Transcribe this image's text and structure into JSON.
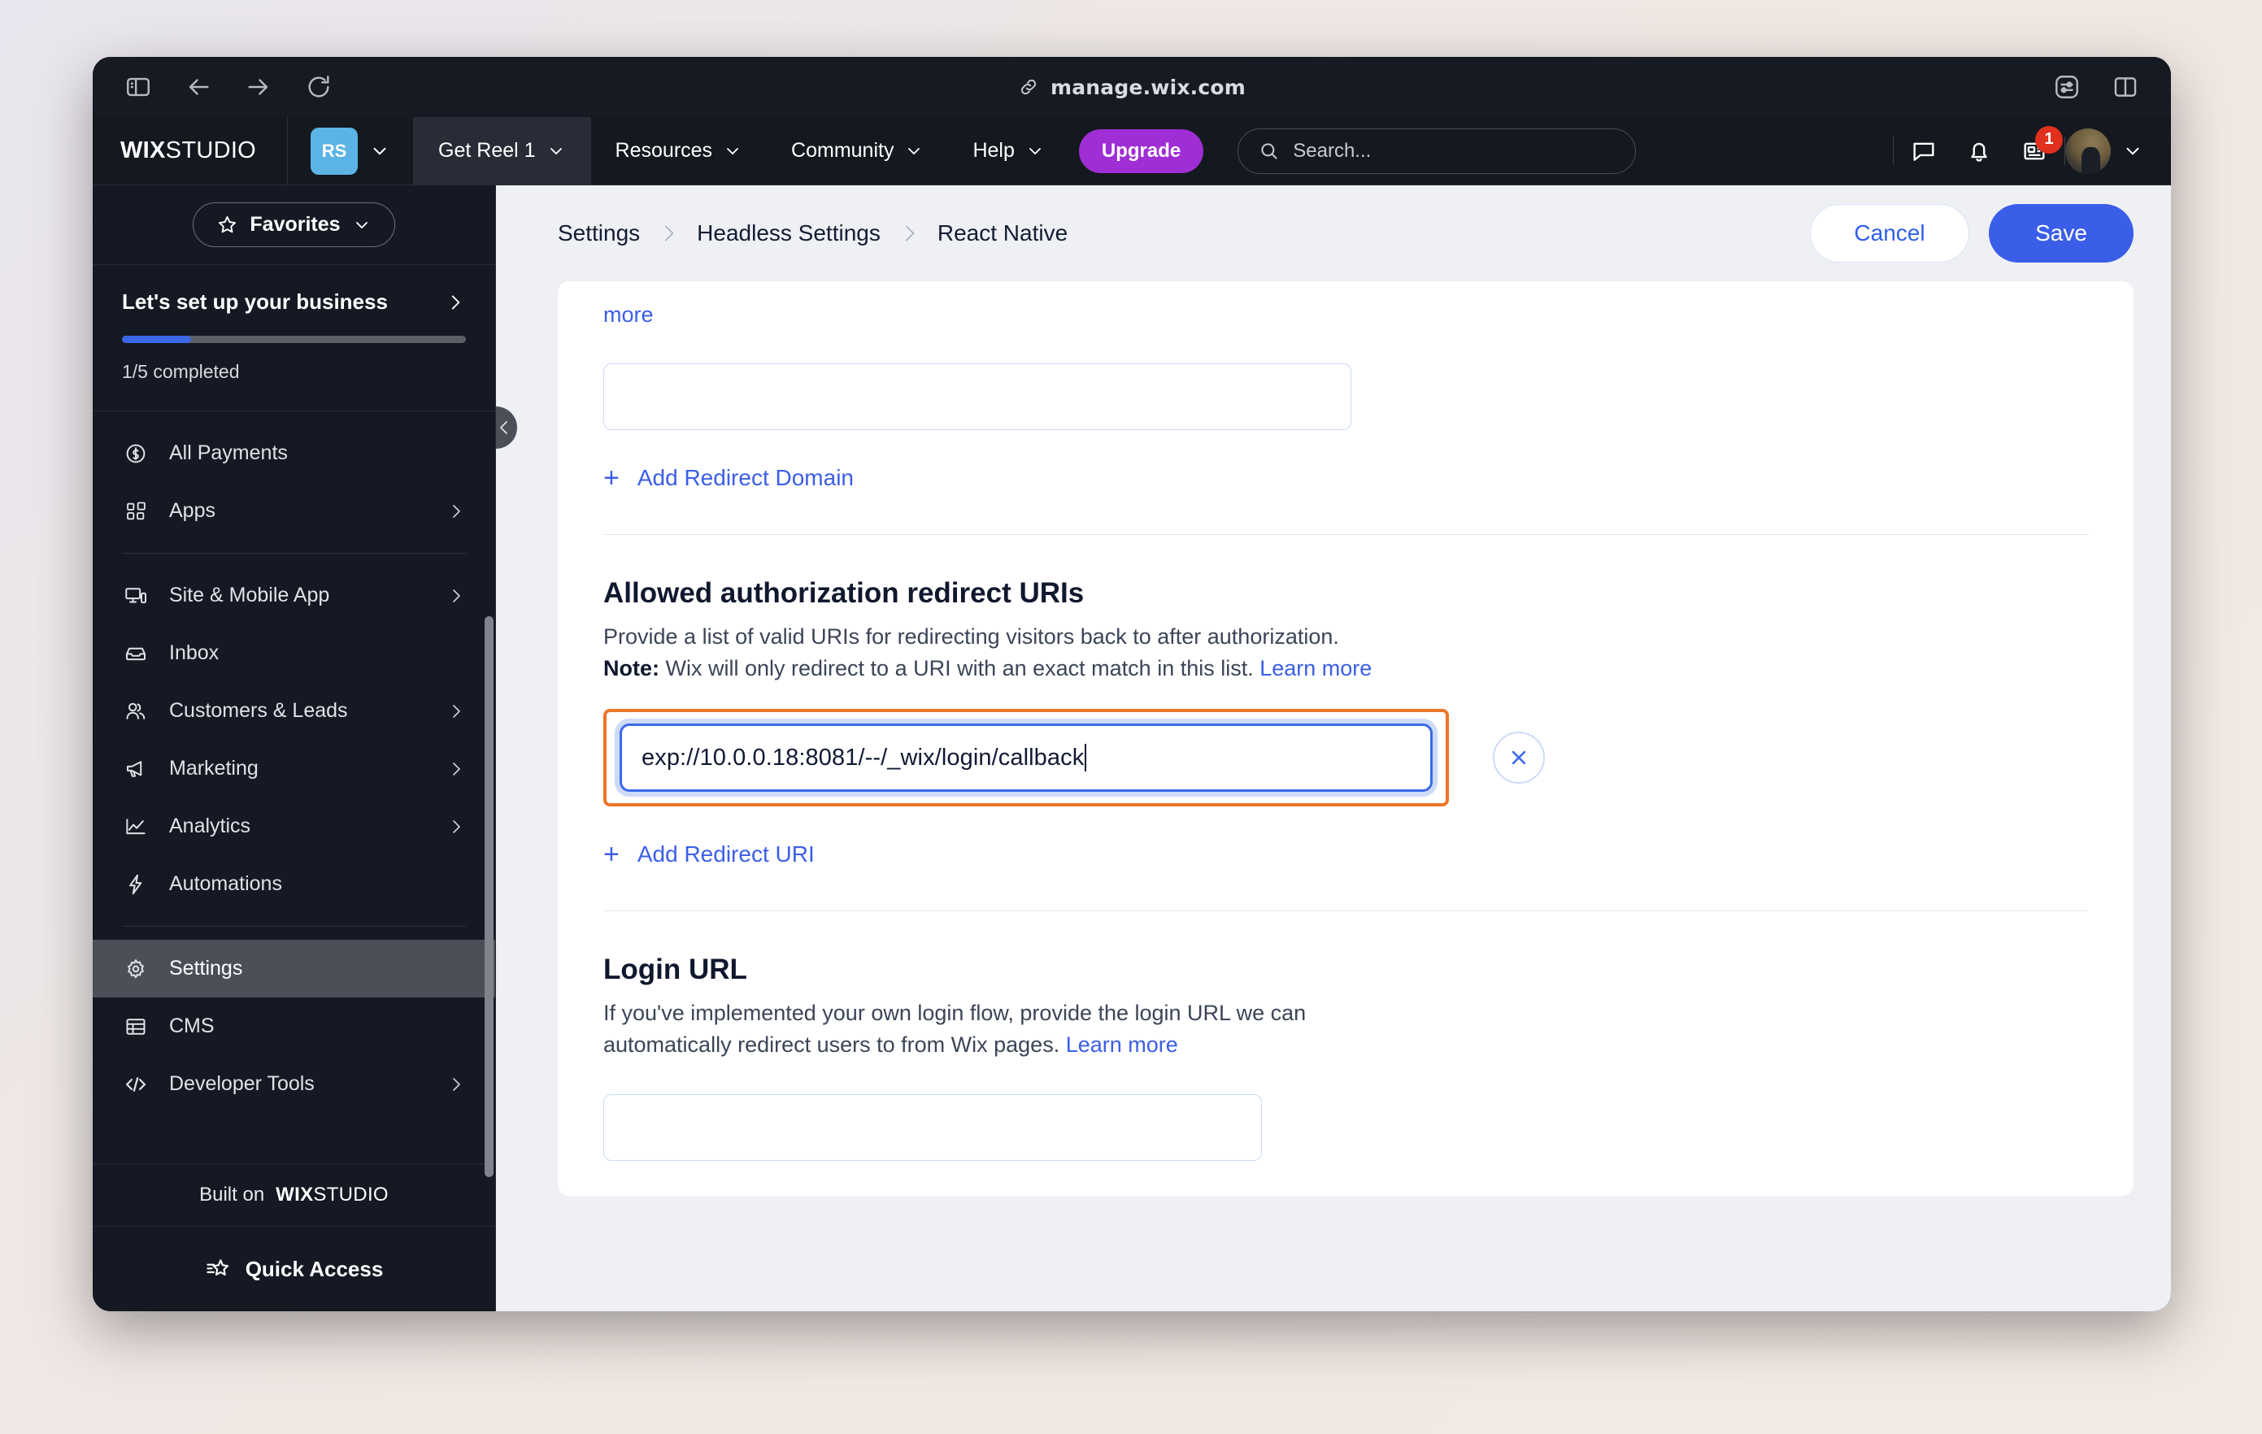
{
  "browser": {
    "url": "manage.wix.com",
    "link_icon": "link-icon",
    "buttons": [
      {
        "name": "sidebar-toggle-icon"
      },
      {
        "name": "back-icon"
      },
      {
        "name": "forward-icon"
      },
      {
        "name": "reload-icon"
      }
    ],
    "right_buttons": [
      {
        "name": "reader-settings-icon"
      },
      {
        "name": "split-view-icon"
      }
    ]
  },
  "topnav": {
    "logo_bold": "WIX",
    "logo_thin": "STUDIO",
    "site_initials": "RS",
    "items": [
      {
        "label": "Get Reel 1",
        "active": true,
        "caret": true
      },
      {
        "label": "Resources",
        "active": false,
        "caret": true
      },
      {
        "label": "Community",
        "active": false,
        "caret": true
      },
      {
        "label": "Help",
        "active": false,
        "caret": true
      }
    ],
    "upgrade_label": "Upgrade",
    "search_placeholder": "Search...",
    "notification_count": "1"
  },
  "sidebar": {
    "favorites_label": "Favorites",
    "setup": {
      "title": "Let's set up your business",
      "progress_text": "1/5 completed",
      "progress_percent": 20
    },
    "items": [
      {
        "label": "All Payments",
        "icon": "dollar-circle-icon",
        "chevron": false
      },
      {
        "label": "Apps",
        "icon": "apps-grid-icon",
        "chevron": true
      },
      {
        "divider": true
      },
      {
        "label": "Site & Mobile App",
        "icon": "devices-icon",
        "chevron": true
      },
      {
        "label": "Inbox",
        "icon": "inbox-icon",
        "chevron": false
      },
      {
        "label": "Customers & Leads",
        "icon": "people-icon",
        "chevron": true
      },
      {
        "label": "Marketing",
        "icon": "megaphone-icon",
        "chevron": true
      },
      {
        "label": "Analytics",
        "icon": "chart-line-icon",
        "chevron": true
      },
      {
        "label": "Automations",
        "icon": "bolt-icon",
        "chevron": false
      },
      {
        "divider": true
      },
      {
        "label": "Settings",
        "icon": "gear-icon",
        "chevron": false,
        "selected": true
      },
      {
        "label": "CMS",
        "icon": "table-icon",
        "chevron": false
      },
      {
        "label": "Developer Tools",
        "icon": "code-icon",
        "chevron": true
      }
    ],
    "built_on_prefix": "Built on",
    "built_on_bold": "WIX",
    "built_on_thin": "STUDIO",
    "quick_access_label": "Quick Access"
  },
  "page": {
    "breadcrumbs": [
      "Settings",
      "Headless Settings",
      "React Native"
    ],
    "cancel_label": "Cancel",
    "save_label": "Save",
    "redirect_domain": {
      "trailing_link_text": "more",
      "field_value": "",
      "add_label": "Add Redirect Domain"
    },
    "redirect_uris": {
      "title": "Allowed authorization redirect URIs",
      "desc_line1": "Provide a list of valid URIs for redirecting visitors back to after authorization.",
      "note_label": "Note:",
      "desc_line2": " Wix will only redirect to a URI with an exact match in this list. ",
      "learn_more": "Learn more",
      "uri_value": "exp://10.0.0.18:8081/--/_wix/login/callback",
      "remove_icon": "close-icon",
      "add_label": "Add Redirect URI"
    },
    "login_url": {
      "title": "Login URL",
      "desc": "If you've implemented your own login flow, provide the login URL we can automatically redirect users to from Wix pages. ",
      "learn_more": "Learn more",
      "field_value": ""
    }
  },
  "colors": {
    "accent_blue": "#3b5ee8",
    "highlight_orange": "#ec7628",
    "upgrade_purple": "#9f2ed4",
    "badge_red": "#e0301e",
    "site_avatar_blue": "#5bb4e5"
  }
}
